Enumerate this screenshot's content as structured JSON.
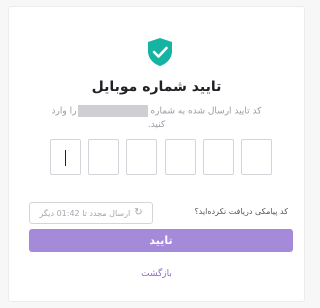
{
  "header": {
    "icon": "shield-check-icon",
    "title": "تایید شماره موبایل"
  },
  "description": {
    "line1_start": "کد تایید ارسال شده به شماره",
    "line1_end": "را وارد",
    "line2": "کنید."
  },
  "otp": {
    "digits": [
      "",
      "",
      "",
      "",
      "",
      ""
    ]
  },
  "resend": {
    "label": "ارسال مجدد تا 01:42 دیگر"
  },
  "not_received": "کد پیامکی دریافت نکرده‌اید؟",
  "confirm_label": "تایید",
  "back_label": "بازگشت",
  "colors": {
    "accent": "#a48ad8",
    "shield": "#15b3a1",
    "link": "#8c6cc8"
  }
}
